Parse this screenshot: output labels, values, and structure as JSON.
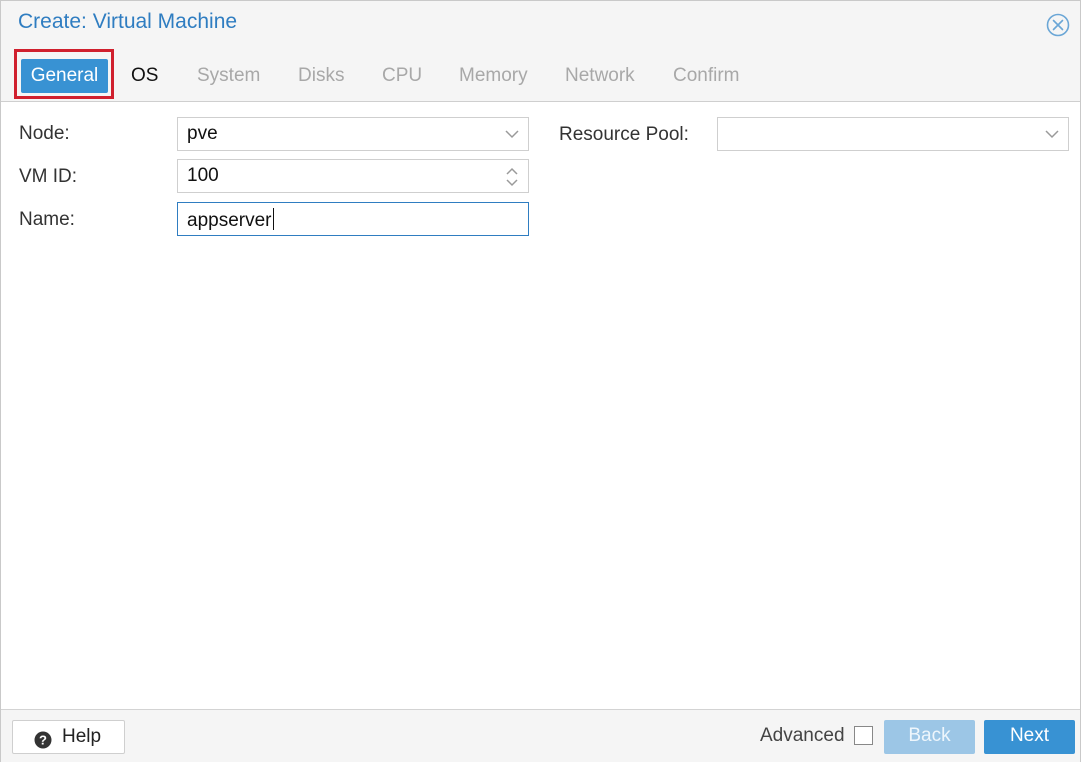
{
  "dialog": {
    "title": "Create: Virtual Machine"
  },
  "tabs": [
    {
      "label": "General",
      "state": "active"
    },
    {
      "label": "OS",
      "state": "enabled"
    },
    {
      "label": "System",
      "state": "disabled"
    },
    {
      "label": "Disks",
      "state": "disabled"
    },
    {
      "label": "CPU",
      "state": "disabled"
    },
    {
      "label": "Memory",
      "state": "disabled"
    },
    {
      "label": "Network",
      "state": "disabled"
    },
    {
      "label": "Confirm",
      "state": "disabled"
    }
  ],
  "form": {
    "node": {
      "label": "Node:",
      "value": "pve"
    },
    "vmid": {
      "label": "VM ID:",
      "value": "100"
    },
    "name": {
      "label": "Name:",
      "value": "appserver"
    },
    "resource_pool": {
      "label": "Resource Pool:",
      "value": ""
    }
  },
  "footer": {
    "help_label": "Help",
    "advanced_label": "Advanced",
    "advanced_checked": false,
    "back_label": "Back",
    "next_label": "Next"
  },
  "colors": {
    "accent": "#3892d3",
    "title": "#2f7dc1",
    "highlight_outline": "#d0202e",
    "disabled_text": "#a8a8a8"
  },
  "icons": {
    "close": "close-circle-icon",
    "dropdown": "chevron-down-icon",
    "spinner": "spinner-arrows-icon",
    "help": "question-circle-icon"
  }
}
